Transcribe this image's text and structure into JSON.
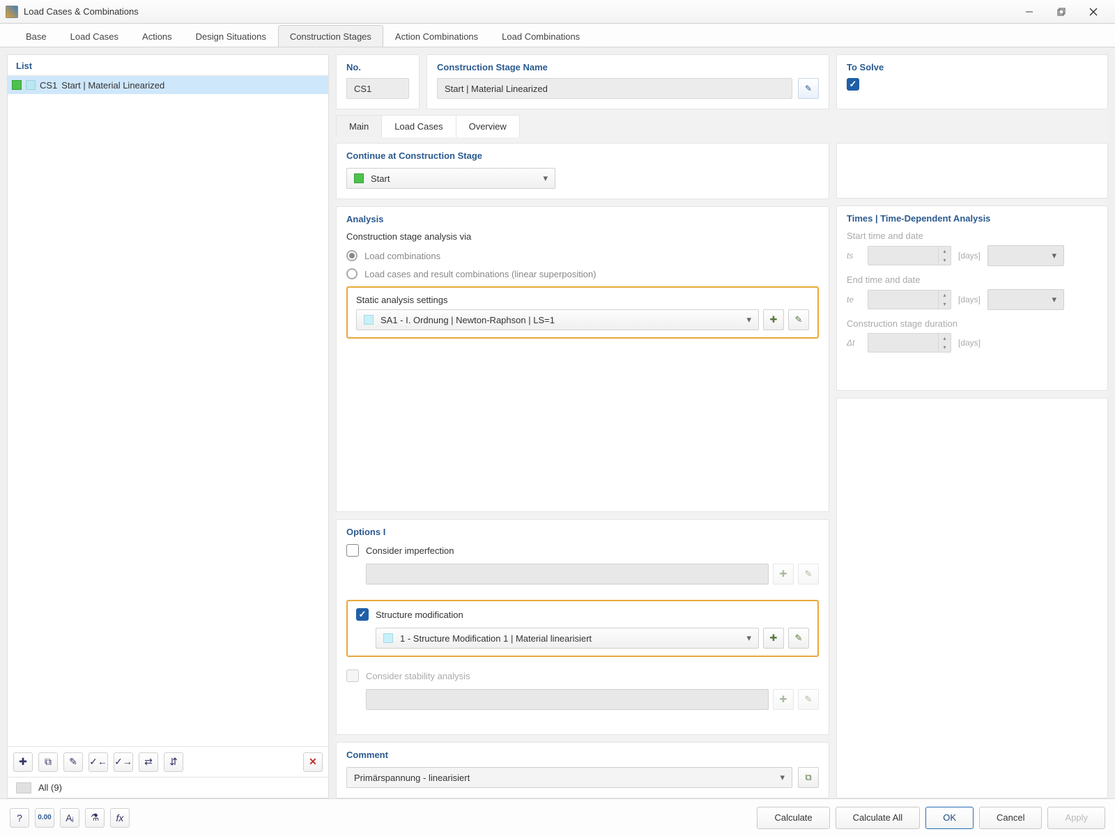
{
  "window": {
    "title": "Load Cases & Combinations"
  },
  "tabs": {
    "items": [
      "Base",
      "Load Cases",
      "Actions",
      "Design Situations",
      "Construction Stages",
      "Action Combinations",
      "Load Combinations"
    ],
    "active": "Construction Stages"
  },
  "left": {
    "title": "List",
    "rows": [
      {
        "id": "CS1",
        "name": "Start | Material Linearized"
      }
    ],
    "footer": "All (9)"
  },
  "stage": {
    "no_label": "No.",
    "no_value": "CS1",
    "name_label": "Construction Stage Name",
    "name_value": "Start | Material Linearized",
    "solve_label": "To Solve"
  },
  "inner_tabs": {
    "items": [
      "Main",
      "Load Cases",
      "Overview"
    ],
    "active": "Main"
  },
  "continue": {
    "title": "Continue at Construction Stage",
    "value": "Start"
  },
  "analysis": {
    "title": "Analysis",
    "via_label": "Construction stage analysis via",
    "opt1": "Load combinations",
    "opt2": "Load cases and result combinations (linear superposition)",
    "sas_label": "Static analysis settings",
    "sas_value": "SA1 - I. Ordnung | Newton-Raphson | LS=1"
  },
  "times": {
    "title": "Times | Time-Dependent Analysis",
    "start_label": "Start time and date",
    "end_label": "End time and date",
    "dur_label": "Construction stage duration",
    "ts": "ts",
    "te": "te",
    "dt": "Δt",
    "unit": "[days]"
  },
  "options": {
    "title": "Options I",
    "imperfection": "Consider imperfection",
    "structmod": "Structure modification",
    "structmod_value": "1 - Structure Modification 1 | Material linearisiert",
    "stability": "Consider stability analysis"
  },
  "comment": {
    "title": "Comment",
    "value": "Primärspannung - linearisiert"
  },
  "buttons": {
    "calc": "Calculate",
    "calc_all": "Calculate All",
    "ok": "OK",
    "cancel": "Cancel",
    "apply": "Apply"
  }
}
